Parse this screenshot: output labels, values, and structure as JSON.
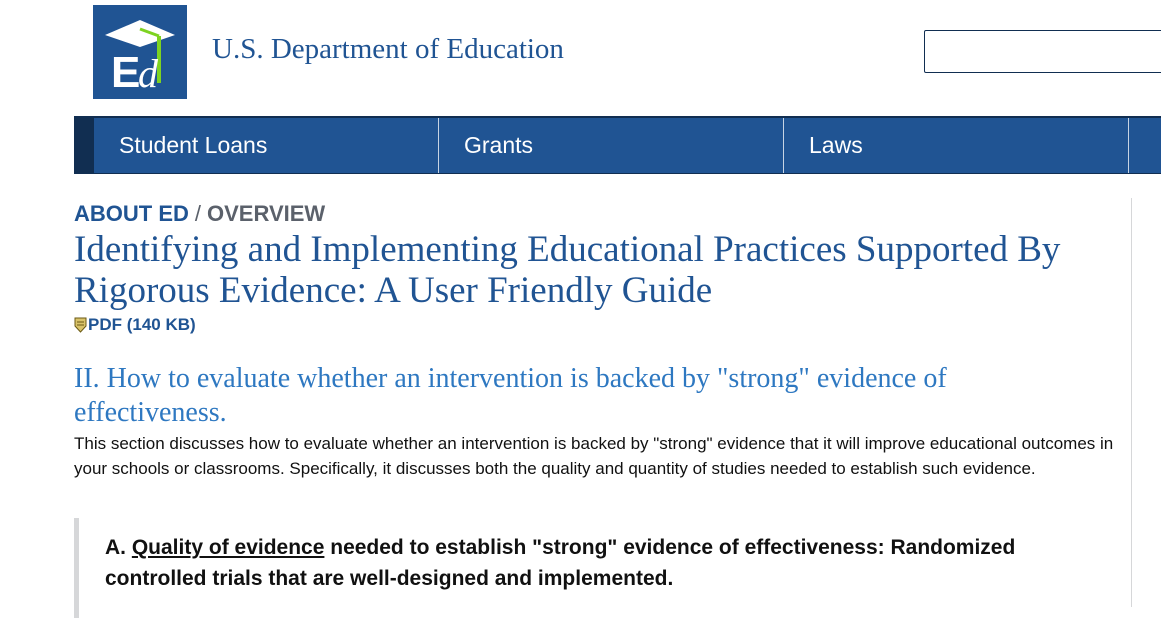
{
  "header": {
    "logo_alt": "Ed",
    "site_title": "U.S. Department of Education",
    "search_value": "",
    "brand_color": "#205493"
  },
  "nav": {
    "items": [
      {
        "label": "Student Loans"
      },
      {
        "label": "Grants"
      },
      {
        "label": "Laws"
      }
    ],
    "nav_color": "#205493"
  },
  "breadcrumb": {
    "parent": "ABOUT ED",
    "separator": "/",
    "current": "OVERVIEW"
  },
  "page": {
    "title": "Identifying and Implementing Educational Practices Supported By Rigorous Evidence: A User Friendly Guide",
    "pdf_link": "PDF (140 KB)",
    "pdf_icon": "pdf-download-icon",
    "section_heading": "II. How to evaluate whether an intervention is backed by \"strong\" evidence of effectiveness.",
    "intro": "This section discusses how to evaluate whether an intervention is backed by \"strong\" evidence that it will improve educational outcomes in your schools or classrooms. Specifically, it discusses both the quality and quantity of studies needed to establish such evidence.",
    "callout": {
      "prefix": "A. ",
      "link_text": "Quality of evidence",
      "rest": " needed to establish \"strong\" evidence of effectiveness: Randomized controlled trials that are well-designed and implemented."
    }
  }
}
